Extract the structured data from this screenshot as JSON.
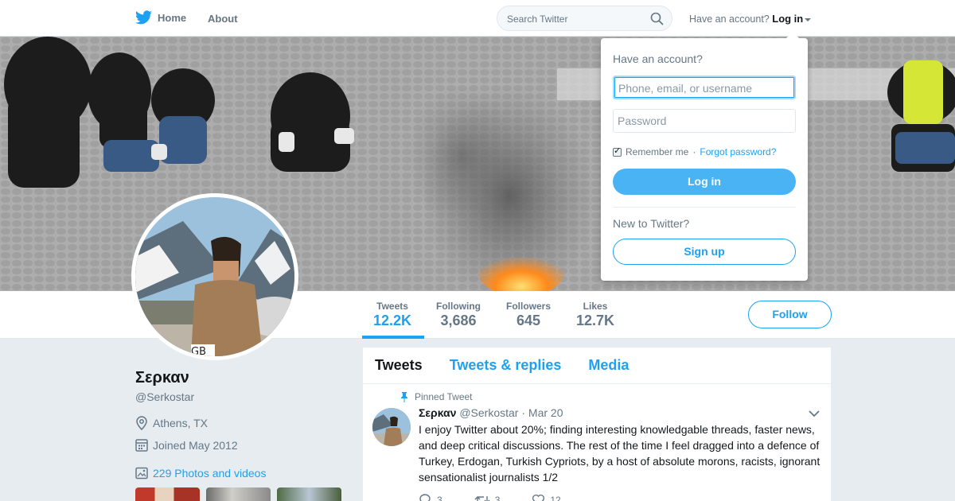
{
  "nav": {
    "home_label": "Home",
    "about_label": "About",
    "search_placeholder": "Search Twitter",
    "have_account": "Have an account?",
    "login_label": "Log in"
  },
  "profile": {
    "name": "Σερκαν",
    "handle": "@Serkostar",
    "location": "Athens, TX",
    "joined": "Joined May 2012",
    "photos_link": "229 Photos and videos"
  },
  "stats": [
    {
      "label": "Tweets",
      "value": "12.2K"
    },
    {
      "label": "Following",
      "value": "3,686"
    },
    {
      "label": "Followers",
      "value": "645"
    },
    {
      "label": "Likes",
      "value": "12.7K"
    }
  ],
  "follow_label": "Follow",
  "timeline": {
    "tabs": [
      "Tweets",
      "Tweets & replies",
      "Media"
    ],
    "pinned_label": "Pinned Tweet",
    "tweet": {
      "author": "Σερκαν",
      "handle": "@Serkostar",
      "date": "· Mar 20",
      "text": "I enjoy Twitter about 20%; finding interesting knowledgable threads, faster news, and deep critical discussions. The rest of the time I feel dragged into a defence of Turkey, Erdogan, Turkish Cypriots, by a host of absolute morons, racists, ignorant sensationalist journalists 1/2",
      "replies": "3",
      "retweets": "3",
      "likes": "12"
    }
  },
  "login_dropdown": {
    "title": "Have an account?",
    "username_placeholder": "Phone, email, or username",
    "password_placeholder": "Password",
    "remember_label": "Remember me",
    "separator": "·",
    "forgot_label": "Forgot password?",
    "login_button": "Log in",
    "new_label": "New to Twitter?",
    "signup_button": "Sign up"
  },
  "colors": {
    "accent": "#1da1f2",
    "login_button": "#4ab3f4",
    "background": "#e6ecf0"
  }
}
